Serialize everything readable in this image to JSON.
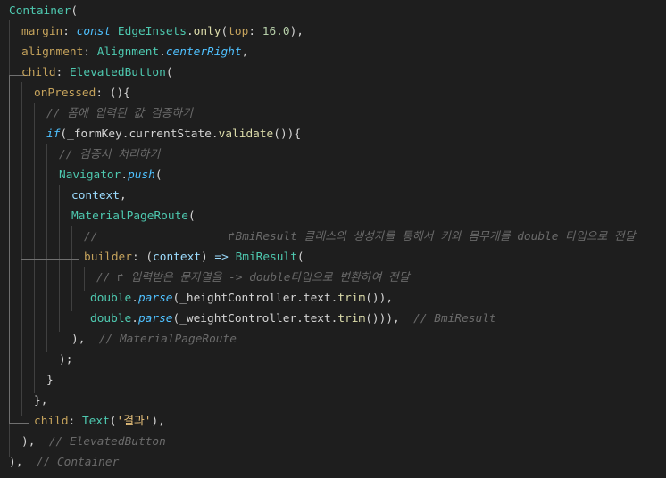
{
  "lines": [
    [
      {
        "t": "Container",
        "c": "class"
      },
      {
        "t": "(",
        "c": "punct"
      }
    ],
    [
      {
        "t": "margin",
        "c": "prop"
      },
      {
        "t": ": ",
        "c": "punct"
      },
      {
        "t": "const",
        "c": "kw"
      },
      {
        "t": " ",
        "c": "punct"
      },
      {
        "t": "EdgeInsets",
        "c": "class"
      },
      {
        "t": ".",
        "c": "punct"
      },
      {
        "t": "only",
        "c": "fn"
      },
      {
        "t": "(",
        "c": "punct"
      },
      {
        "t": "top",
        "c": "prop"
      },
      {
        "t": ": ",
        "c": "punct"
      },
      {
        "t": "16.0",
        "c": "num"
      },
      {
        "t": "),",
        "c": "punct"
      }
    ],
    [
      {
        "t": "alignment",
        "c": "prop"
      },
      {
        "t": ": ",
        "c": "punct"
      },
      {
        "t": "Alignment",
        "c": "class"
      },
      {
        "t": ".",
        "c": "punct"
      },
      {
        "t": "centerRight",
        "c": "method"
      },
      {
        "t": ",",
        "c": "punct"
      }
    ],
    [
      {
        "t": "child",
        "c": "prop"
      },
      {
        "t": ": ",
        "c": "punct"
      },
      {
        "t": "ElevatedButton",
        "c": "class"
      },
      {
        "t": "(",
        "c": "punct"
      }
    ],
    [
      {
        "t": "onPressed",
        "c": "prop"
      },
      {
        "t": ": (){",
        "c": "punct"
      }
    ],
    [
      {
        "t": "// 폼에 입력된 값 검증하기",
        "c": "comment"
      }
    ],
    [
      {
        "t": "if",
        "c": "kw"
      },
      {
        "t": "(_formKey.currentState.",
        "c": "punct"
      },
      {
        "t": "validate",
        "c": "fn"
      },
      {
        "t": "()){",
        "c": "punct"
      }
    ],
    [
      {
        "t": "// 검증시 처리하기",
        "c": "comment"
      }
    ],
    [
      {
        "t": "Navigator",
        "c": "class"
      },
      {
        "t": ".",
        "c": "punct"
      },
      {
        "t": "push",
        "c": "method"
      },
      {
        "t": "(",
        "c": "punct"
      }
    ],
    [
      {
        "t": "context",
        "c": "param"
      },
      {
        "t": ",",
        "c": "punct"
      }
    ],
    [
      {
        "t": "MaterialPageRoute",
        "c": "class"
      },
      {
        "t": "(",
        "c": "punct"
      }
    ],
    [
      {
        "t": "//                   ↱BmiResult 클래스의 생성자를 통해서 키와 몸무게를 double 타입으로 전달",
        "c": "comment"
      }
    ],
    [
      {
        "t": "builder",
        "c": "prop"
      },
      {
        "t": ": (",
        "c": "punct"
      },
      {
        "t": "context",
        "c": "param"
      },
      {
        "t": ") ",
        "c": "punct"
      },
      {
        "t": "=>",
        "c": "arrow"
      },
      {
        "t": " ",
        "c": "punct"
      },
      {
        "t": "BmiResult",
        "c": "class"
      },
      {
        "t": "(",
        "c": "punct"
      }
    ],
    [
      {
        "t": "// ↱ 입력받은 문자열을 -> double타입으로 변환하여 전달",
        "c": "comment"
      }
    ],
    [
      {
        "t": "double",
        "c": "class"
      },
      {
        "t": ".",
        "c": "punct"
      },
      {
        "t": "parse",
        "c": "method"
      },
      {
        "t": "(_heightController.text.",
        "c": "punct"
      },
      {
        "t": "trim",
        "c": "fn"
      },
      {
        "t": "()),",
        "c": "punct"
      }
    ],
    [
      {
        "t": "double",
        "c": "class"
      },
      {
        "t": ".",
        "c": "punct"
      },
      {
        "t": "parse",
        "c": "method"
      },
      {
        "t": "(_weightController.text.",
        "c": "punct"
      },
      {
        "t": "trim",
        "c": "fn"
      },
      {
        "t": "())),  ",
        "c": "punct"
      },
      {
        "t": "// BmiResult",
        "c": "comment"
      }
    ],
    [
      {
        "t": "),  ",
        "c": "punct"
      },
      {
        "t": "// MaterialPageRoute",
        "c": "comment"
      }
    ],
    [
      {
        "t": ");",
        "c": "punct"
      }
    ],
    [
      {
        "t": "}",
        "c": "punct"
      }
    ],
    [
      {
        "t": "},",
        "c": "punct"
      }
    ],
    [
      {
        "t": "child",
        "c": "prop"
      },
      {
        "t": ": ",
        "c": "punct"
      },
      {
        "t": "Text",
        "c": "class"
      },
      {
        "t": "(",
        "c": "punct"
      },
      {
        "t": "'결과'",
        "c": "str"
      },
      {
        "t": "),",
        "c": "punct"
      }
    ],
    [
      {
        "t": "),  ",
        "c": "punct"
      },
      {
        "t": "// ElevatedButton",
        "c": "comment"
      }
    ],
    [
      {
        "t": "),  ",
        "c": "punct"
      },
      {
        "t": "// Container",
        "c": "comment"
      }
    ]
  ]
}
